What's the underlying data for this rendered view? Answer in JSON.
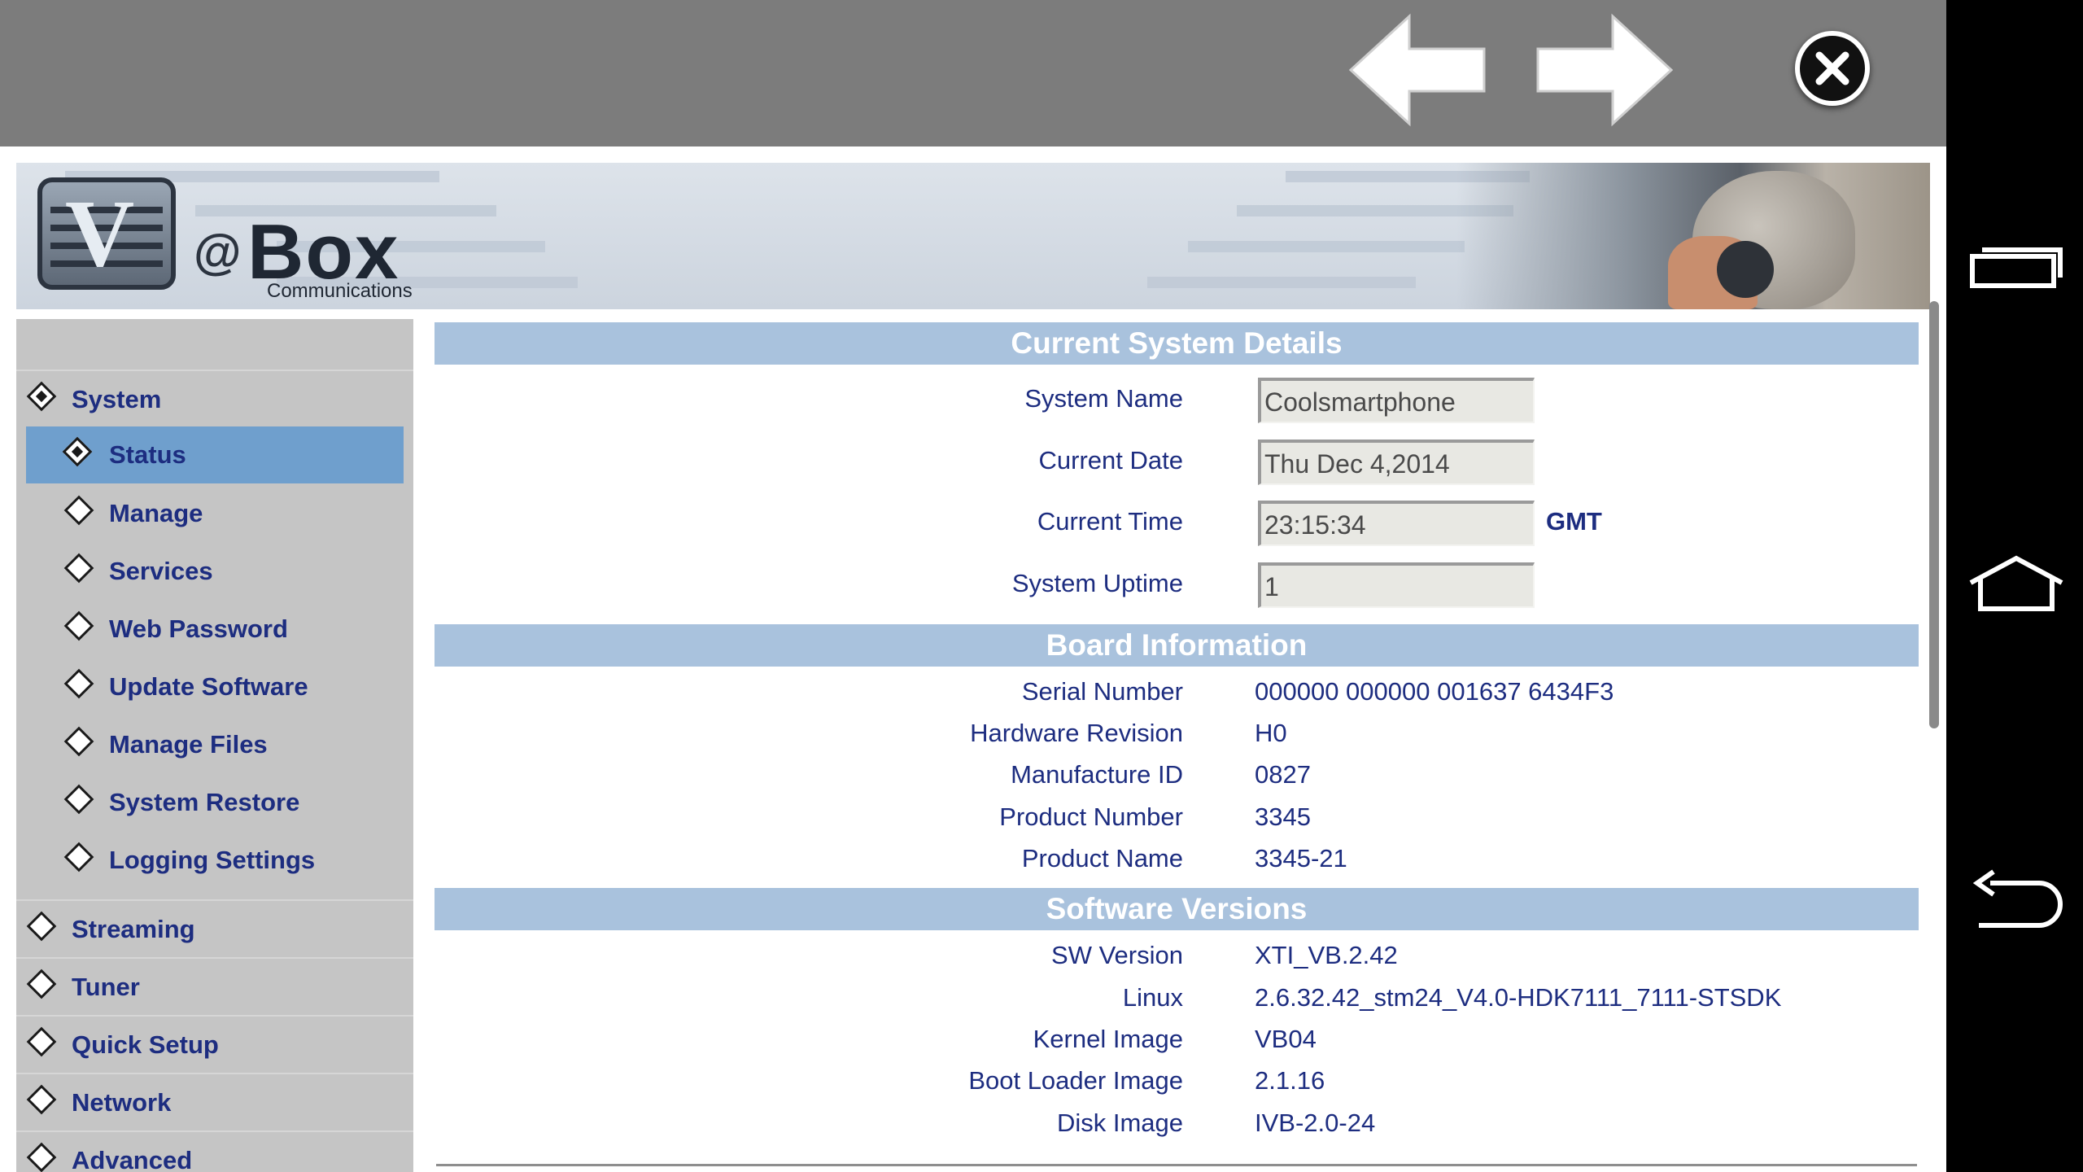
{
  "branding": {
    "logo_letter": "V",
    "logo_at": "@",
    "logo_word": "Box",
    "logo_sub": "Communications"
  },
  "sidebar": {
    "items": [
      {
        "label": "System",
        "level": 1,
        "active": false,
        "filled": true
      },
      {
        "label": "Status",
        "level": 2,
        "active": true,
        "filled": true
      },
      {
        "label": "Manage",
        "level": 2,
        "active": false,
        "filled": false
      },
      {
        "label": "Services",
        "level": 2,
        "active": false,
        "filled": false
      },
      {
        "label": "Web Password",
        "level": 2,
        "active": false,
        "filled": false
      },
      {
        "label": "Update Software",
        "level": 2,
        "active": false,
        "filled": false
      },
      {
        "label": "Manage Files",
        "level": 2,
        "active": false,
        "filled": false
      },
      {
        "label": "System Restore",
        "level": 2,
        "active": false,
        "filled": false
      },
      {
        "label": "Logging Settings",
        "level": 2,
        "active": false,
        "filled": false
      },
      {
        "label": "Streaming",
        "level": 1,
        "active": false,
        "filled": false
      },
      {
        "label": "Tuner",
        "level": 1,
        "active": false,
        "filled": false
      },
      {
        "label": "Quick Setup",
        "level": 1,
        "active": false,
        "filled": false
      },
      {
        "label": "Network",
        "level": 1,
        "active": false,
        "filled": false
      },
      {
        "label": "Advanced",
        "level": 1,
        "active": false,
        "filled": false
      }
    ]
  },
  "system_details": {
    "title": "Current System Details",
    "system_name_label": "System Name",
    "system_name_value": "Coolsmartphone",
    "current_date_label": "Current Date",
    "current_date_value": "Thu Dec 4,2014",
    "current_time_label": "Current Time",
    "current_time_value": "23:15:34",
    "timezone": "GMT",
    "uptime_label": "System Uptime",
    "uptime_value": "1"
  },
  "board_info": {
    "title": "Board Information",
    "rows": [
      {
        "label": "Serial Number",
        "value": "000000 000000 001637 6434F3"
      },
      {
        "label": "Hardware Revision",
        "value": "H0"
      },
      {
        "label": "Manufacture ID",
        "value": "0827"
      },
      {
        "label": "Product Number",
        "value": "3345"
      },
      {
        "label": "Product Name",
        "value": "3345-21"
      }
    ]
  },
  "software_versions": {
    "title": "Software Versions",
    "rows": [
      {
        "label": "SW Version",
        "value": "XTI_VB.2.42"
      },
      {
        "label": "Linux",
        "value": "2.6.32.42_stm24_V4.0-HDK7111_7111-STSDK"
      },
      {
        "label": "Kernel Image",
        "value": "VB04"
      },
      {
        "label": "Boot Loader Image",
        "value": "2.1.16"
      },
      {
        "label": "Disk Image",
        "value": "IVB-2.0-24"
      }
    ]
  },
  "icons": {
    "back": "arrow-left-icon",
    "forward": "arrow-right-icon",
    "close": "close-icon",
    "recent_apps": "recent-apps-icon",
    "home": "home-icon",
    "system_back": "back-icon"
  },
  "colors": {
    "section_header_bg": "#a9c2dd",
    "active_menu_bg": "#6f9fcd",
    "menu_text": "#1d2d80",
    "sidebar_bg": "#c5c5c5",
    "topbar_bg": "#7c7c7c"
  }
}
